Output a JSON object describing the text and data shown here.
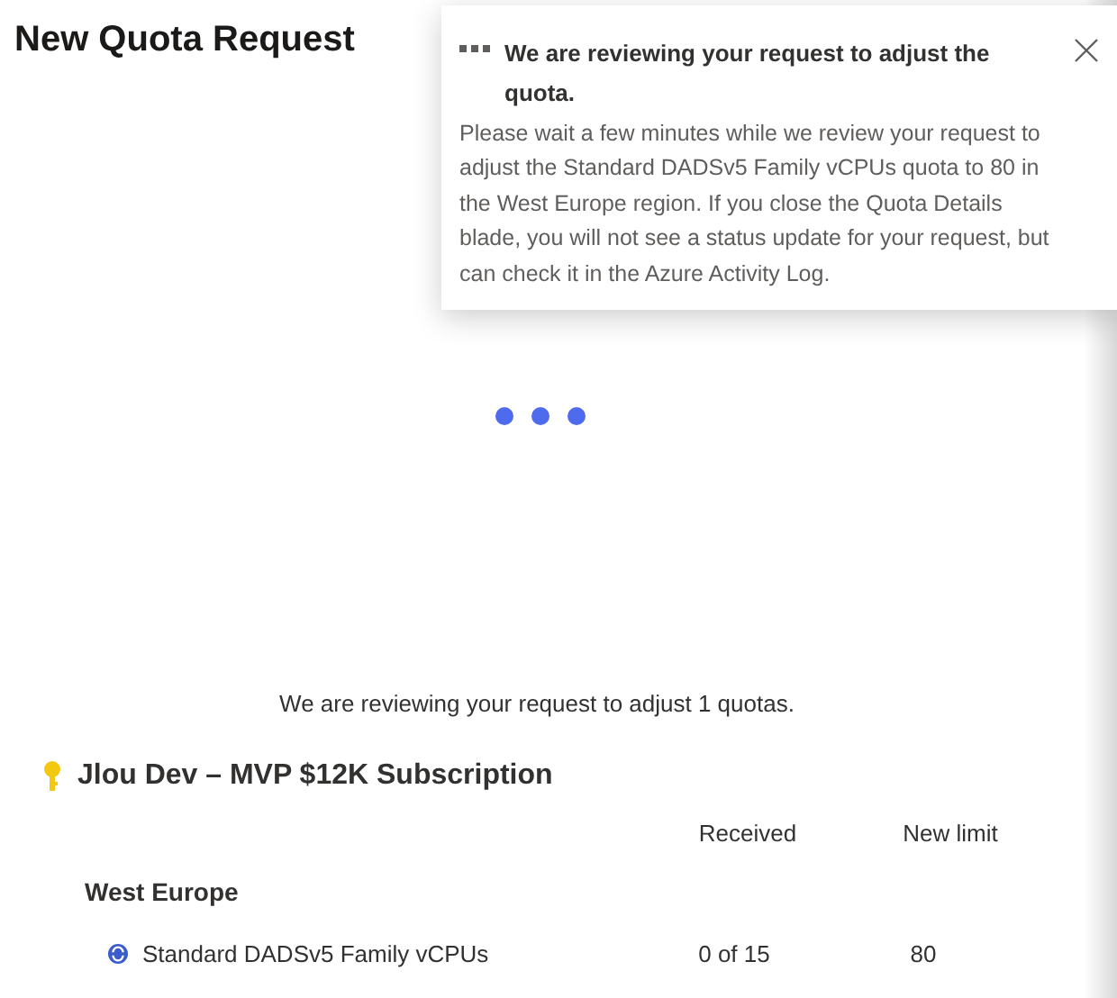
{
  "page_title": "New Quota Request",
  "notification": {
    "title": "We are reviewing your request to adjust the quota.",
    "message": "Please wait a few minutes while we review your request to adjust the Standard DADSv5 Family vCPUs quota to 80 in the West Europe region. If you close the Quota Details blade, you will not see a status update for your request, but can check it in the Azure Activity Log."
  },
  "status_message": "We are reviewing your request to adjust 1 quotas.",
  "subscription": "Jlou Dev – MVP $12K Subscription",
  "table": {
    "columns": [
      "Received",
      "New limit"
    ],
    "groups": [
      {
        "region": "West Europe",
        "rows": [
          {
            "name": "Standard DADSv5 Family vCPUs",
            "received": "0 of 15",
            "new_limit": "80"
          }
        ]
      }
    ]
  }
}
